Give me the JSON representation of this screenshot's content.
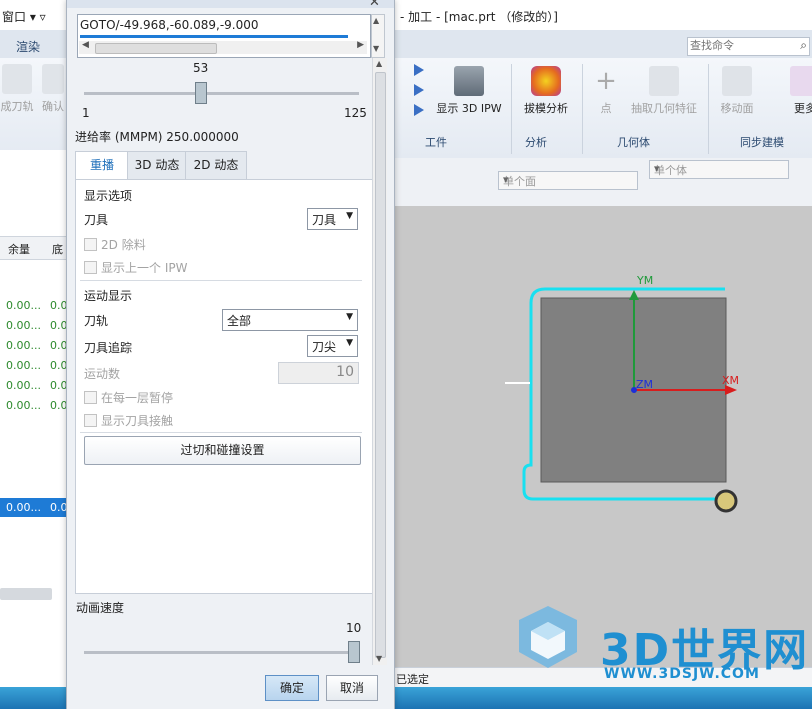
{
  "app": {
    "menu_left": "窗口 ▾ ▿",
    "title": "- 加工 - [mac.prt （修改的）]",
    "ribbon_tab": "渲染",
    "search_placeholder": "查找命令",
    "left_ribbon_labels": [
      "成刀轨",
      "确认"
    ],
    "buttons": {
      "ipw": "显示 3D IPW",
      "draft": "拔模分析",
      "point": "点",
      "extract": "抽取几何特征",
      "move_face": "移动面",
      "more": "更多"
    },
    "groups": {
      "workpiece": "工件",
      "analysis": "分析",
      "geometry": "几何体",
      "sync": "同步建模"
    },
    "face_filter": "单个面",
    "body_filter": "单个体",
    "status_text": "已选定",
    "left_columns": [
      "余量",
      "底"
    ],
    "left_rows": [
      [
        "0.00...",
        "0.0"
      ],
      [
        "0.00...",
        "0.0"
      ],
      [
        "0.00...",
        "0.0"
      ],
      [
        "0.00...",
        "0.0"
      ],
      [
        "0.00...",
        "0.0"
      ],
      [
        "0.00...",
        "0.0"
      ]
    ],
    "left_selected_row": [
      "0.00...",
      "0.0"
    ]
  },
  "axes": {
    "ym": "YM",
    "xm": "XM",
    "zm": "ZM"
  },
  "watermark": {
    "brand": "3D世界网",
    "url": "WWW.3DSJW.COM"
  },
  "dialog": {
    "goto_text": "GOTO/-49.968,-60.089,-9.000",
    "step": {
      "current": "53",
      "min": "1",
      "max": "125",
      "fraction": 0.42
    },
    "feed_rate": "进给率 (MMPM) 250.000000",
    "tabs": [
      "重播",
      "3D 动态",
      "2D 动态"
    ],
    "display_options": {
      "title": "显示选项",
      "tool_label": "刀具",
      "tool_value": "刀具",
      "remove_2d": "2D 除料",
      "show_prev_ipw": "显示上一个 IPW"
    },
    "motion_display": {
      "title": "运动显示",
      "path_label": "刀轨",
      "path_value": "全部",
      "trace_label": "刀具追踪",
      "trace_value": "刀尖",
      "motion_count_label": "运动数",
      "motion_count_value": "10",
      "pause_each_layer": "在每一层暂停",
      "show_tool_contact": "显示刀具接触"
    },
    "collision_button": "过切和碰撞设置",
    "anim_speed_label": "动画速度",
    "anim_speed_value": "10",
    "ok": "确定",
    "cancel": "取消"
  }
}
